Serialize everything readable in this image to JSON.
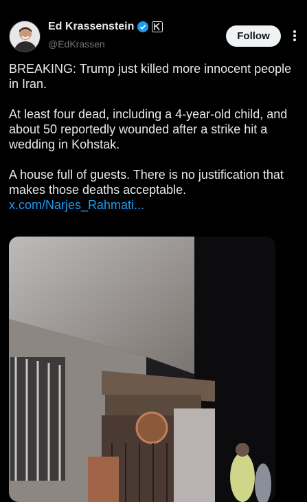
{
  "author": {
    "name": "Ed Krassenstein",
    "handle": "@EdKrassen"
  },
  "actions": {
    "follow_label": "Follow"
  },
  "post": {
    "paragraphs": [
      "BREAKING:  Trump just killed more innocent people in Iran.",
      "At least four dead, including a 4-year-old child, and about 50 reportedly wounded after a strike hit a wedding in Kohstak.",
      "A house full of guests. There is no justification that makes those deaths acceptable."
    ],
    "link_text": "x.com/Narjes_Rahmati..."
  },
  "icons": {
    "verified": "verified-badge-icon",
    "affiliate": "k-affiliation-icon",
    "more": "more-options-icon"
  },
  "colors": {
    "background": "#000000",
    "link": "#1d9bf0",
    "verified": "#1d9bf0",
    "muted": "#71767b"
  }
}
